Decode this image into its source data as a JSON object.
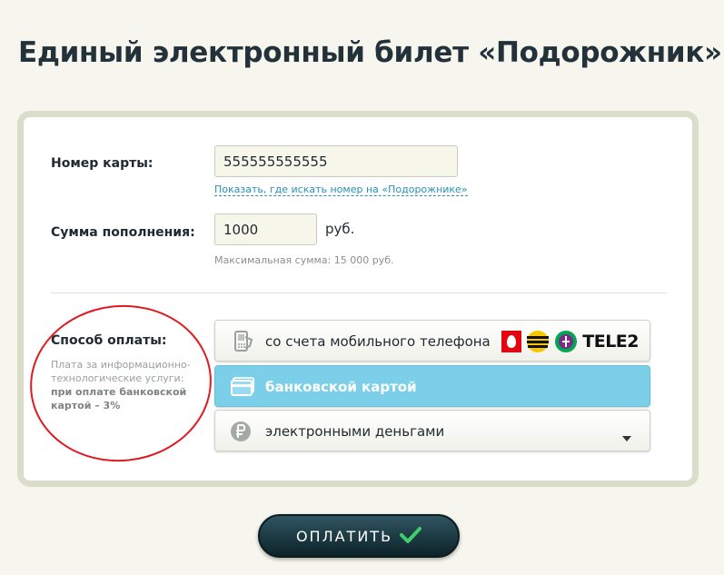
{
  "page": {
    "title": "Единый электронный билет «Подорожник»"
  },
  "card_number": {
    "label": "Номер карты:",
    "value": "555555555555",
    "help_link": "Показать, где искать номер на «Подорожнике»"
  },
  "amount": {
    "label": "Сумма пополнения:",
    "value": "1000",
    "currency": "руб.",
    "max_hint": "Максимальная сумма: 15 000 руб."
  },
  "payment": {
    "label": "Способ оплаты:",
    "fee_note": "Плата за информационно-технологические услуги:",
    "fee_note_strong": "при оплате банковской картой – 3%",
    "options": [
      {
        "label": "со счета мобильного телефона",
        "icon": "mobile-phone-icon"
      },
      {
        "label": "банковской картой",
        "icon": "bank-card-icon",
        "selected": true
      },
      {
        "label": "электронными деньгами",
        "icon": "ruble-coin-icon"
      }
    ],
    "carriers": {
      "tele2": "TELE2"
    }
  },
  "submit": {
    "label": "ОПЛАТИТЬ"
  },
  "colors": {
    "background": "#f7f6ee",
    "card_border": "#d9ddc9",
    "selected_option": "#7ccfe8",
    "link": "#2b8fb7",
    "button": "#0d2229",
    "check": "#3fcf6a",
    "annotation": "#e01a22"
  }
}
